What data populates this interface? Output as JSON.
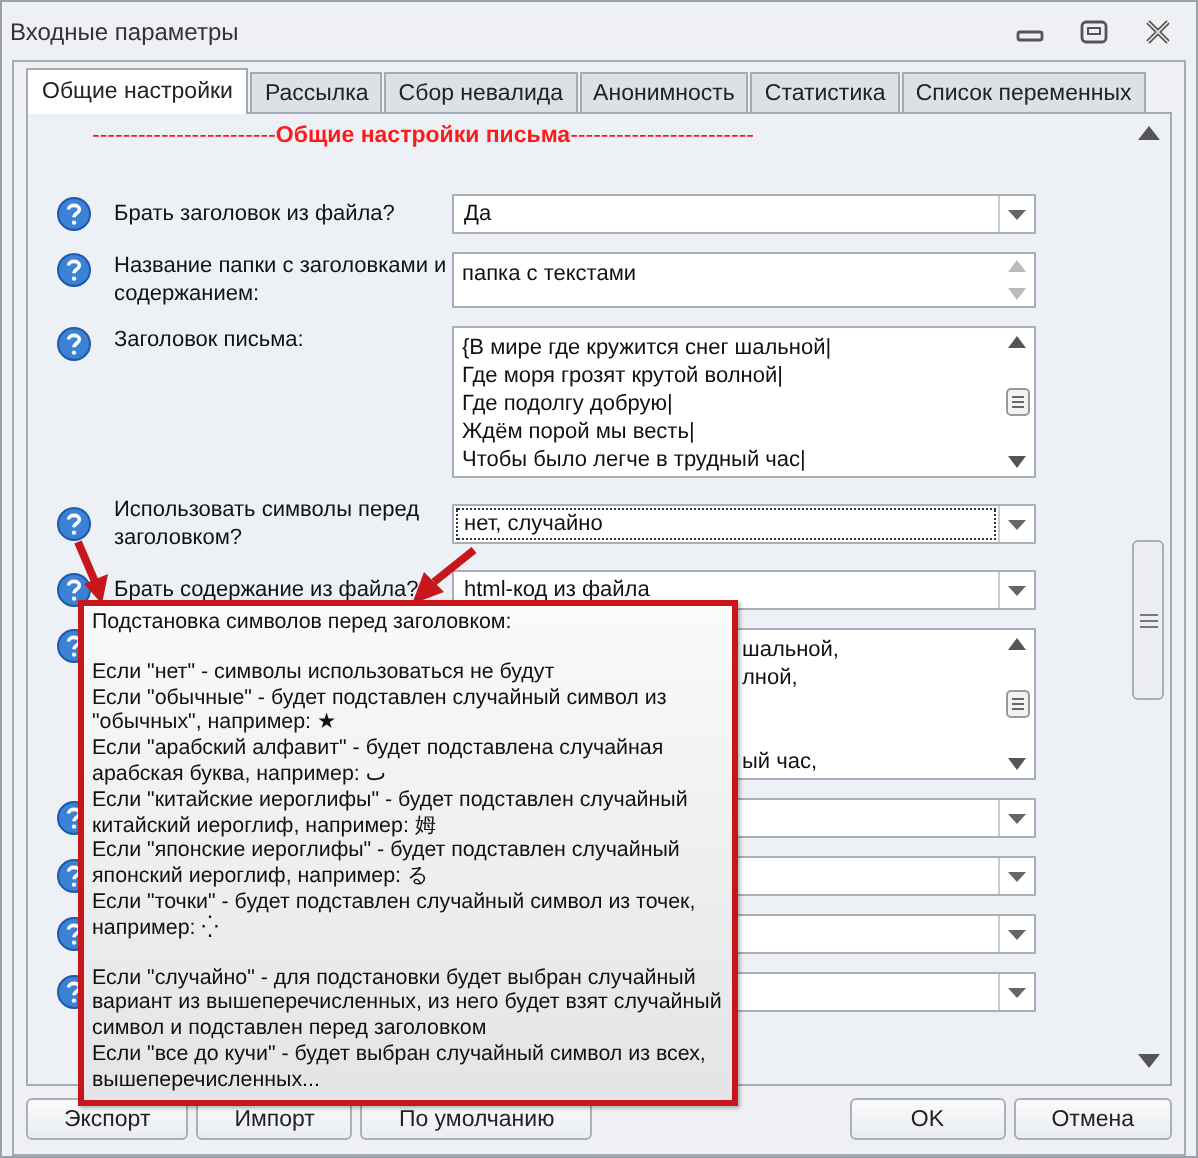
{
  "window": {
    "title": "Входные параметры"
  },
  "tabs": [
    {
      "label": "Общие настройки",
      "selected": true
    },
    {
      "label": "Рассылка",
      "selected": false
    },
    {
      "label": "Сбор невалида",
      "selected": false
    },
    {
      "label": "Анонимность",
      "selected": false
    },
    {
      "label": "Статистика",
      "selected": false
    },
    {
      "label": "Список переменных",
      "selected": false
    }
  ],
  "section_header": "------------------------**Общие настройки письма**------------------------",
  "fields": [
    {
      "kind": "dropdown",
      "label": "Брать заголовок из файла?",
      "value": "Да",
      "focused": false
    },
    {
      "kind": "textarea_short",
      "label": "Название папки с заголовками и содержанием:",
      "lines": [
        {
          "text": "папка с текстами"
        }
      ]
    },
    {
      "kind": "textarea",
      "label": "Заголовок письма:",
      "lines": [
        {
          "text": "{В мире где кружится снег шальной|"
        },
        {
          "text": "Где моря грозят крутой волной|"
        },
        {
          "text": "Где подолгу добрую|"
        },
        {
          "text": "Ждём порой мы весть|"
        },
        {
          "text": "Чтобы было легче в трудный час|"
        }
      ]
    },
    {
      "kind": "dropdown",
      "label": "Использовать символы перед заголовком?",
      "value": "нет, случайно",
      "focused": true
    },
    {
      "kind": "dropdown",
      "label": "Брать содержание из файла?",
      "value": "html-код из файла",
      "focused": false
    },
    {
      "kind": "textarea_covered",
      "lines": [
        {
          "text": "шальной,",
          "spaced": false
        },
        {
          "text": "лной,",
          "spaced": false
        },
        {
          "text": "ый час,",
          "spaced": true
        }
      ]
    },
    {
      "kind": "dropdown",
      "focused": false
    },
    {
      "kind": "dropdown",
      "focused": false
    },
    {
      "kind": "dropdown",
      "focused": false
    },
    {
      "kind": "dropdown",
      "focused": false
    }
  ],
  "tooltip": {
    "paragraphs": [
      {
        "text": "Подстановка символов перед заголовком:",
        "spaced": false
      },
      {
        "text": "Если \"нет\" - символы использоваться не будут",
        "spaced": true
      },
      {
        "text": "Если \"обычные\" - будет подставлен случайный символ из \"обычных\", например: ★",
        "spaced": false
      },
      {
        "text": "Если \"арабский алфавит\" - будет подставлена случайная арабская буква, например: ٮ",
        "spaced": false
      },
      {
        "text": "Если \"китайские иероглифы\" - будет подставлен случайный китайский иероглиф, например: 姆",
        "spaced": false
      },
      {
        "text": "Если \"японские иероглифы\" - будет подставлен случайный японский иероглиф, например: る",
        "spaced": false
      },
      {
        "text": "Если \"точки\" - будет подставлен случайный символ из точек, например: ⁛",
        "spaced": false
      },
      {
        "text": "Если \"случайно\" - для подстановки будет выбран случайный вариант из вышеперечисленных, из него будет взят случайный символ и подставлен перед заголовком",
        "spaced": true
      },
      {
        "text": "Если \"все до кучи\" - будет выбран случайный символ из всех, вышеперечисленных...",
        "spaced": false
      }
    ]
  },
  "buttons_left": [
    "Экспорт",
    "Импорт",
    "По умолчанию"
  ],
  "buttons_right": [
    "OK",
    "Отмена"
  ]
}
